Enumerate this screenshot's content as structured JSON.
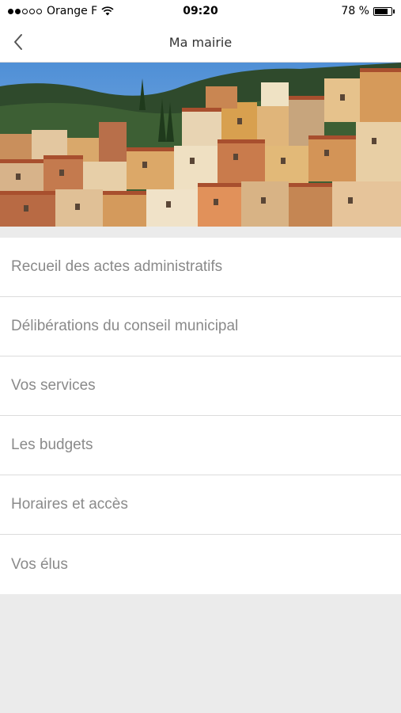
{
  "status_bar": {
    "carrier": "Orange F",
    "signal_filled": 2,
    "signal_total": 5,
    "time": "09:20",
    "battery_percent": "78 %",
    "battery_level": 0.78
  },
  "nav": {
    "title": "Ma mairie",
    "back_icon": "chevron-left-icon"
  },
  "hero": {
    "image": "village-photo"
  },
  "menu": {
    "items": [
      {
        "label": "Recueil des actes administratifs"
      },
      {
        "label": "Délibérations du conseil municipal"
      },
      {
        "label": "Vos services"
      },
      {
        "label": "Les budgets"
      },
      {
        "label": "Horaires et accès"
      },
      {
        "label": "Vos élus"
      }
    ]
  },
  "colors": {
    "background": "#ebebeb",
    "menu_text": "#8a8a8a",
    "separator": "#dcdcdc"
  }
}
